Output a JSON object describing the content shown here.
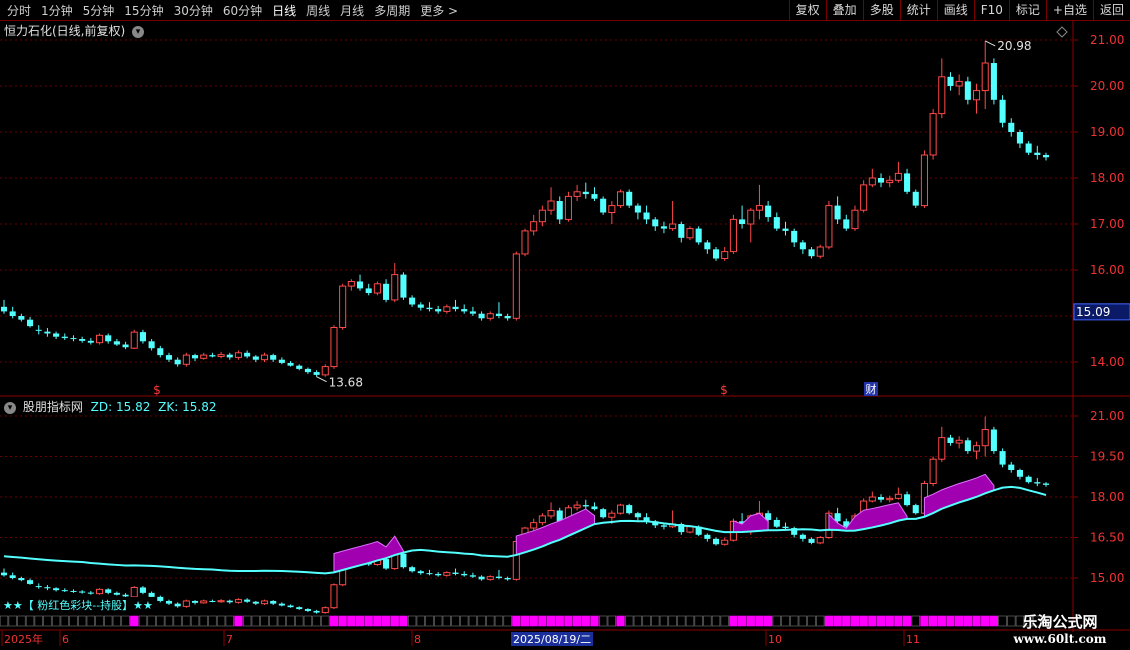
{
  "toolbar": {
    "periods": [
      "分时",
      "1分钟",
      "5分钟",
      "15分钟",
      "30分钟",
      "60分钟",
      "日线",
      "周线",
      "月线",
      "多周期",
      "更多 >"
    ],
    "active_period": "日线",
    "actions": [
      "复权",
      "叠加",
      "多股",
      "统计",
      "画线",
      "F10",
      "标记",
      "+自选",
      "返回"
    ]
  },
  "main_chart": {
    "title": "恒力石化(日线,前复权)",
    "y_ticks": [
      "21.00",
      "20.00",
      "19.00",
      "18.00",
      "17.00",
      "16.00",
      "15.00",
      "14.00"
    ],
    "current_price": "15.09",
    "high_label": "20.98",
    "low_label": "13.68",
    "markers": [
      "$",
      "$",
      "财"
    ]
  },
  "indicator_chart": {
    "name": "股朋指标网",
    "zd_label": "ZD: 15.82",
    "zk_label": "ZK: 15.82",
    "y_ticks": [
      "21.00",
      "19.50",
      "18.00",
      "16.50",
      "15.00"
    ],
    "legend": "★★【 粉红色彩块--持股】★★"
  },
  "date_axis": {
    "labels": [
      "2025年",
      "6",
      "7",
      "8",
      "2025/08/19/二",
      "10",
      "11"
    ]
  },
  "colors": {
    "up": "#ff4a4a",
    "down": "#54ffff",
    "band": "#a000b0",
    "hold_block": "#ff00ff",
    "axis_red": "#8b0000"
  },
  "watermark": {
    "title": "乐淘公式网",
    "url": "www.60lt.com"
  },
  "chart_data": {
    "type": "candlestick",
    "ohlc": [
      [
        15.2,
        15.35,
        15.05,
        15.1
      ],
      [
        15.1,
        15.2,
        14.95,
        15.0
      ],
      [
        15.0,
        15.05,
        14.88,
        14.92
      ],
      [
        14.92,
        14.98,
        14.75,
        14.78
      ],
      [
        14.7,
        14.8,
        14.6,
        14.68
      ],
      [
        14.66,
        14.74,
        14.55,
        14.62
      ],
      [
        14.62,
        14.66,
        14.5,
        14.55
      ],
      [
        14.55,
        14.62,
        14.48,
        14.52
      ],
      [
        14.52,
        14.58,
        14.45,
        14.5
      ],
      [
        14.5,
        14.55,
        14.42,
        14.46
      ],
      [
        14.46,
        14.52,
        14.38,
        14.42
      ],
      [
        14.42,
        14.62,
        14.38,
        14.58
      ],
      [
        14.58,
        14.62,
        14.4,
        14.45
      ],
      [
        14.45,
        14.5,
        14.35,
        14.38
      ],
      [
        14.38,
        14.44,
        14.28,
        14.32
      ],
      [
        14.3,
        14.7,
        14.28,
        14.65
      ],
      [
        14.65,
        14.7,
        14.4,
        14.45
      ],
      [
        14.45,
        14.5,
        14.25,
        14.3
      ],
      [
        14.3,
        14.35,
        14.1,
        14.15
      ],
      [
        14.15,
        14.2,
        14.0,
        14.05
      ],
      [
        14.05,
        14.1,
        13.9,
        13.95
      ],
      [
        13.95,
        14.2,
        13.9,
        14.15
      ],
      [
        14.15,
        14.18,
        14.02,
        14.08
      ],
      [
        14.08,
        14.2,
        14.05,
        14.15
      ],
      [
        14.15,
        14.2,
        14.1,
        14.12
      ],
      [
        14.12,
        14.22,
        14.08,
        14.16
      ],
      [
        14.16,
        14.2,
        14.05,
        14.1
      ],
      [
        14.1,
        14.25,
        14.05,
        14.2
      ],
      [
        14.2,
        14.25,
        14.08,
        14.12
      ],
      [
        14.12,
        14.15,
        14.0,
        14.05
      ],
      [
        14.05,
        14.2,
        14.0,
        14.15
      ],
      [
        14.15,
        14.18,
        14.0,
        14.05
      ],
      [
        14.05,
        14.1,
        13.95,
        13.98
      ],
      [
        13.98,
        14.02,
        13.9,
        13.92
      ],
      [
        13.92,
        13.95,
        13.82,
        13.85
      ],
      [
        13.85,
        13.88,
        13.74,
        13.78
      ],
      [
        13.78,
        13.82,
        13.68,
        13.72
      ],
      [
        13.72,
        13.95,
        13.68,
        13.9
      ],
      [
        13.9,
        14.8,
        13.85,
        14.75
      ],
      [
        14.75,
        15.7,
        14.7,
        15.65
      ],
      [
        15.65,
        15.8,
        15.55,
        15.75
      ],
      [
        15.75,
        15.9,
        15.55,
        15.6
      ],
      [
        15.6,
        15.7,
        15.45,
        15.5
      ],
      [
        15.5,
        15.75,
        15.45,
        15.7
      ],
      [
        15.7,
        15.8,
        15.3,
        15.35
      ],
      [
        15.35,
        16.15,
        15.3,
        15.9
      ],
      [
        15.9,
        15.95,
        15.35,
        15.4
      ],
      [
        15.4,
        15.45,
        15.2,
        15.25
      ],
      [
        15.25,
        15.3,
        15.12,
        15.18
      ],
      [
        15.18,
        15.3,
        15.1,
        15.15
      ],
      [
        15.15,
        15.22,
        15.05,
        15.1
      ],
      [
        15.1,
        15.25,
        15.05,
        15.2
      ],
      [
        15.2,
        15.35,
        15.1,
        15.15
      ],
      [
        15.15,
        15.25,
        15.05,
        15.1
      ],
      [
        15.1,
        15.2,
        15.0,
        15.05
      ],
      [
        15.05,
        15.1,
        14.9,
        14.95
      ],
      [
        14.95,
        15.1,
        14.9,
        15.05
      ],
      [
        15.05,
        15.3,
        14.95,
        15.0
      ],
      [
        15.0,
        15.05,
        14.9,
        14.95
      ],
      [
        14.95,
        16.4,
        14.9,
        16.35
      ],
      [
        16.35,
        16.9,
        16.3,
        16.85
      ],
      [
        16.85,
        17.2,
        16.75,
        17.05
      ],
      [
        17.05,
        17.4,
        16.95,
        17.3
      ],
      [
        17.3,
        17.8,
        17.2,
        17.5
      ],
      [
        17.5,
        17.6,
        17.0,
        17.1
      ],
      [
        17.1,
        17.7,
        17.05,
        17.6
      ],
      [
        17.6,
        17.85,
        17.5,
        17.7
      ],
      [
        17.7,
        17.9,
        17.55,
        17.65
      ],
      [
        17.65,
        17.8,
        17.5,
        17.55
      ],
      [
        17.55,
        17.6,
        17.2,
        17.25
      ],
      [
        17.25,
        17.5,
        17.0,
        17.4
      ],
      [
        17.4,
        17.75,
        17.35,
        17.7
      ],
      [
        17.7,
        17.75,
        17.35,
        17.4
      ],
      [
        17.4,
        17.45,
        17.1,
        17.25
      ],
      [
        17.25,
        17.4,
        17.0,
        17.1
      ],
      [
        17.1,
        17.15,
        16.85,
        16.95
      ],
      [
        16.95,
        17.05,
        16.8,
        16.9
      ],
      [
        16.9,
        17.5,
        16.85,
        17.0
      ],
      [
        17.0,
        17.05,
        16.6,
        16.7
      ],
      [
        16.7,
        16.95,
        16.65,
        16.9
      ],
      [
        16.9,
        16.95,
        16.55,
        16.6
      ],
      [
        16.6,
        16.65,
        16.35,
        16.45
      ],
      [
        16.45,
        16.5,
        16.2,
        16.25
      ],
      [
        16.25,
        16.5,
        16.2,
        16.4
      ],
      [
        16.4,
        17.2,
        16.35,
        17.1
      ],
      [
        17.1,
        17.4,
        16.9,
        17.0
      ],
      [
        17.0,
        17.35,
        16.6,
        17.3
      ],
      [
        17.3,
        17.85,
        17.1,
        17.4
      ],
      [
        17.4,
        17.5,
        17.05,
        17.15
      ],
      [
        17.15,
        17.25,
        16.85,
        16.9
      ],
      [
        16.9,
        17.05,
        16.75,
        16.85
      ],
      [
        16.85,
        16.9,
        16.5,
        16.6
      ],
      [
        16.6,
        16.65,
        16.35,
        16.45
      ],
      [
        16.45,
        16.5,
        16.25,
        16.3
      ],
      [
        16.3,
        16.55,
        16.25,
        16.5
      ],
      [
        16.5,
        17.5,
        16.45,
        17.4
      ],
      [
        17.4,
        17.6,
        17.0,
        17.1
      ],
      [
        17.1,
        17.2,
        16.85,
        16.9
      ],
      [
        16.9,
        17.4,
        16.85,
        17.3
      ],
      [
        17.3,
        17.95,
        17.25,
        17.85
      ],
      [
        17.85,
        18.2,
        17.8,
        18.0
      ],
      [
        18.0,
        18.1,
        17.8,
        17.9
      ],
      [
        17.9,
        18.05,
        17.8,
        17.95
      ],
      [
        17.95,
        18.35,
        17.9,
        18.1
      ],
      [
        18.1,
        18.2,
        17.65,
        17.7
      ],
      [
        17.7,
        17.75,
        17.35,
        17.4
      ],
      [
        17.4,
        18.6,
        17.35,
        18.5
      ],
      [
        18.5,
        19.5,
        18.4,
        19.4
      ],
      [
        19.4,
        20.6,
        19.3,
        20.2
      ],
      [
        20.2,
        20.3,
        19.9,
        20.0
      ],
      [
        20.0,
        20.25,
        19.8,
        20.1
      ],
      [
        20.1,
        20.2,
        19.6,
        19.7
      ],
      [
        19.7,
        20.05,
        19.4,
        19.9
      ],
      [
        19.9,
        20.98,
        19.5,
        20.5
      ],
      [
        20.5,
        20.6,
        19.6,
        19.7
      ],
      [
        19.7,
        19.8,
        19.1,
        19.2
      ],
      [
        19.2,
        19.3,
        18.9,
        19.0
      ],
      [
        19.0,
        19.05,
        18.65,
        18.75
      ],
      [
        18.75,
        18.8,
        18.5,
        18.55
      ],
      [
        18.55,
        18.7,
        18.4,
        18.5
      ],
      [
        18.5,
        18.55,
        18.38,
        18.45
      ]
    ]
  }
}
